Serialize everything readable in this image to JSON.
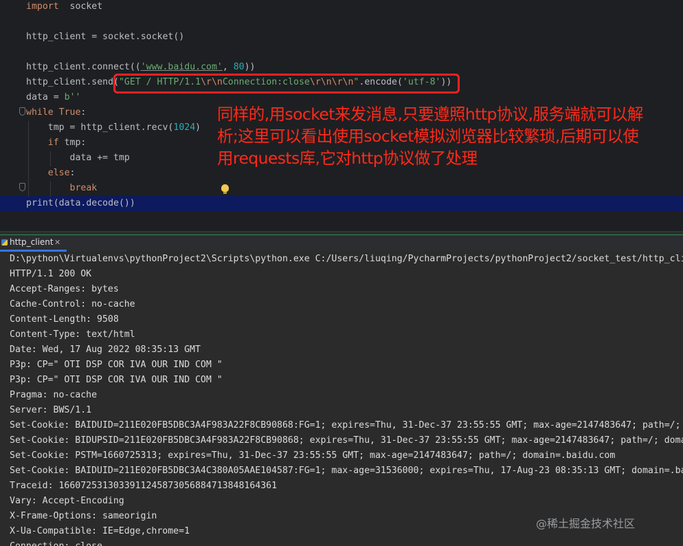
{
  "editor": {
    "lines": [
      {
        "parts": [
          [
            "kw",
            "import"
          ],
          [
            "",
            "  socket"
          ]
        ]
      },
      {
        "parts": []
      },
      {
        "parts": [
          [
            "",
            "http_client = socket.socket()"
          ]
        ]
      },
      {
        "parts": []
      },
      {
        "parts": [
          [
            "",
            "http_client.connect(("
          ],
          [
            "str underline-str",
            "'www.baidu.com'"
          ],
          [
            "",
            ", "
          ],
          [
            "num",
            "80"
          ],
          [
            "",
            "))"
          ]
        ]
      },
      {
        "parts": [
          [
            "",
            "http_client.send("
          ],
          [
            "str",
            "\"GET / HTTP/1.1"
          ],
          [
            "esc",
            "\\r\\n"
          ],
          [
            "str",
            "Connection:close"
          ],
          [
            "esc",
            "\\r\\n\\r\\n"
          ],
          [
            "str",
            "\""
          ],
          [
            "",
            ".encode("
          ],
          [
            "str",
            "'utf-8'"
          ],
          [
            "",
            "))"
          ]
        ]
      },
      {
        "parts": [
          [
            "",
            "data = "
          ],
          [
            "str",
            "b''"
          ]
        ]
      },
      {
        "parts": [
          [
            "kw",
            "while"
          ],
          [
            "",
            " "
          ],
          [
            "kw",
            "True"
          ],
          [
            "",
            ":"
          ]
        ]
      },
      {
        "parts": [
          [
            "",
            "    tmp = http_client.recv("
          ],
          [
            "num",
            "1024"
          ],
          [
            "",
            ")"
          ]
        ]
      },
      {
        "parts": [
          [
            "",
            "    "
          ],
          [
            "kw",
            "if"
          ],
          [
            "",
            " tmp:"
          ]
        ]
      },
      {
        "parts": [
          [
            "",
            "        data += tmp"
          ]
        ]
      },
      {
        "parts": [
          [
            "",
            "    "
          ],
          [
            "kw",
            "else"
          ],
          [
            "",
            ":"
          ]
        ]
      },
      {
        "parts": [
          [
            "",
            "        "
          ],
          [
            "kw",
            "break"
          ]
        ]
      },
      {
        "parts": [
          [
            "",
            "print(data.decode())"
          ]
        ]
      }
    ],
    "annotation": "同样的,用socket来发消息,只要遵照http协议,服务端就可以解\n析;这里可以看出使用socket模拟浏览器比较繁琐,后期可以使\n用requests库,它对http协议做了处理"
  },
  "run_tab": {
    "label": "http_client",
    "close": "✕",
    "icon": "python-file-icon"
  },
  "console": {
    "lines": [
      "D:\\python\\Virtualenvs\\pythonProject2\\Scripts\\python.exe C:/Users/liuqing/PycharmProjects/pythonProject2/socket_test/http_client.py",
      "HTTP/1.1 200 OK",
      "Accept-Ranges: bytes",
      "Cache-Control: no-cache",
      "Content-Length: 9508",
      "Content-Type: text/html",
      "Date: Wed, 17 Aug 2022 08:35:13 GMT",
      "P3p: CP=\" OTI DSP COR IVA OUR IND COM \"",
      "P3p: CP=\" OTI DSP COR IVA OUR IND COM \"",
      "Pragma: no-cache",
      "Server: BWS/1.1",
      "Set-Cookie: BAIDUID=211E020FB5DBC3A4F983A22F8CB90868:FG=1; expires=Thu, 31-Dec-37 23:55:55 GMT; max-age=2147483647; path=/; domain=.baidu.com",
      "Set-Cookie: BIDUPSID=211E020FB5DBC3A4F983A22F8CB90868; expires=Thu, 31-Dec-37 23:55:55 GMT; max-age=2147483647; path=/; domain=.baidu.com",
      "Set-Cookie: PSTM=1660725313; expires=Thu, 31-Dec-37 23:55:55 GMT; max-age=2147483647; path=/; domain=.baidu.com",
      "Set-Cookie: BAIDUID=211E020FB5DBC3A4C380A05AAE104587:FG=1; max-age=31536000; expires=Thu, 17-Aug-23 08:35:13 GMT; domain=.baidu.com",
      "Traceid: 1660725313033911245873056884713848164361",
      "Vary: Accept-Encoding",
      "X-Frame-Options: sameorigin",
      "X-Ua-Compatible: IE=Edge,chrome=1",
      "Connection: close"
    ]
  },
  "watermark": "@稀土掘金技术社区",
  "colors": {
    "annotation": "#ff2a1a",
    "highlight_box": "#ff1f1f",
    "current_line": "#0d1a5e",
    "tab_underline": "#3574f0"
  }
}
